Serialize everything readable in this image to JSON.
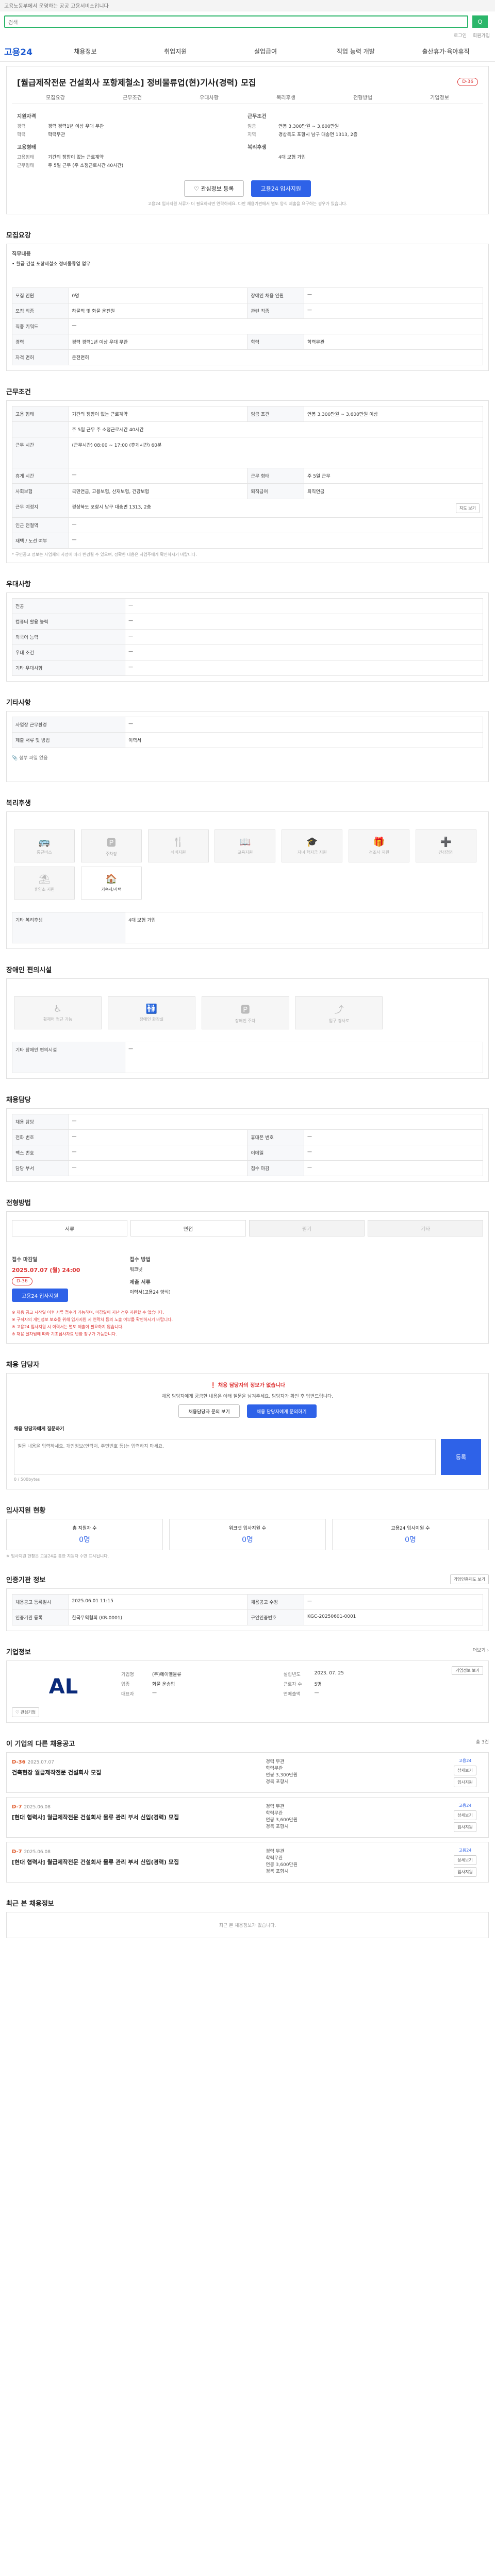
{
  "topbar": {
    "notice": "고용노동부에서 운영하는 공공 고용서비스입니다"
  },
  "search": {
    "placeholder": "검색",
    "button": "Q"
  },
  "util": {
    "login": "로그인",
    "join": "회원가입"
  },
  "nav": {
    "logo": "고용24",
    "items": [
      "채용정보",
      "취업지원",
      "실업급여",
      "직업 능력 개발",
      "출산휴가·육아휴직"
    ]
  },
  "header": {
    "tabs": [
      "모집요강",
      "근무조건",
      "우대사항",
      "복리후생",
      "전형방법",
      "기업정보"
    ],
    "title": "[월급제작전문 건설회사 포항제철소] 정비물류업(현)기사(경력) 모집",
    "dday": "D-36",
    "left_head": "지원자격",
    "right_head": "근무조건",
    "left_kv": [
      {
        "k": "경력",
        "v": "경력 경력1년 이상 우대 무관"
      },
      {
        "k": "학력",
        "v": "학력무관"
      }
    ],
    "right_kv": [
      {
        "k": "임금",
        "v": "연봉 3,300만원 ~ 3,600만원"
      },
      {
        "k": "지역",
        "v": "경상북도 포항시 남구 대송면 1313, 2층"
      }
    ],
    "left_head2": "고용형태",
    "right_head2": "복리후생",
    "left_kv2": [
      {
        "k": "고용형태",
        "v": "기간의 정함이 없는 근로계약"
      },
      {
        "k": "근무형태",
        "v": "주 5일 근무 (주 소정근로시간 40시간)"
      }
    ],
    "right_kv2": [
      {
        "k": "",
        "v": "4대 보험 가입"
      }
    ],
    "btn_save": "♡ 관심정보 등록",
    "btn_apply": "고용24 입사지원",
    "note": "고용24 입사지원 서류가 더 필요하시면 연락하세요. 다만 채용기관에서 별도 양식 제출을 요구하는 경우가 있습니다."
  },
  "recruit": {
    "heading": "모집요강",
    "duty_label": "직무내용",
    "duty": "• 월급 건설 포항제철소 정비물류업 업무",
    "rows": [
      {
        "k1": "모집 인원",
        "v1": "0명",
        "k2": "장애인 채용 인원",
        "v2": "—"
      },
      {
        "k1": "모집 직종",
        "v1": "하물적 및 화물 운전원",
        "k2": "관련 직종",
        "v2": "—"
      },
      {
        "k1": "직종 키워드",
        "v1": "—",
        "k2": "",
        "v2": ""
      },
      {
        "k1": "경력",
        "v1": "경력 경력1년 이상 우대 무관",
        "k2": "학력",
        "v2": "학력무관"
      },
      {
        "k1": "자격 면허",
        "v1": "운전면허"
      }
    ]
  },
  "conditions": {
    "heading": "근무조건",
    "rows": [
      {
        "k1": "고용 형태",
        "v1": "기간의 정함이 없는 근로계약",
        "k2": "임금 조건",
        "v2": "연봉 3,300만원 ~ 3,600만원 이상"
      },
      {
        "k1": "",
        "v1": "주 5일 근무 주 소정근로시간 40시간",
        "k2": "",
        "v2": ""
      },
      {
        "k1": "근무 시간",
        "v1": "(근무시간) 08:00 ~ 17:00 (휴게시간) 60분",
        "k2": "",
        "v2": ""
      },
      {
        "k1": "휴게 시간",
        "v1": "—",
        "k2": "근무 형태",
        "v2": "주 5일 근무"
      },
      {
        "k1": "사회보험",
        "v1": "국민연금, 고용보험, 산재보험, 건강보험",
        "k2": "퇴직급여",
        "v2": "퇴직연금"
      },
      {
        "k1": "근무 예정지",
        "v1": "경상북도 포항시 남구 대송면 1313, 2층",
        "k2": "",
        "v2": ""
      },
      {
        "k1": "인근 전철역",
        "v1": "—"
      },
      {
        "k1": "재택 / 노선 여부",
        "v1": "—"
      }
    ],
    "map_btn": "지도 보기",
    "note": "* 구인공고 정보는 사업체의 사정에 따라 변경될 수 있으며, 정확한 내용은 사업주에게 확인하시기 바랍니다."
  },
  "prefer": {
    "heading": "우대사항",
    "rows": [
      {
        "k": "전공",
        "v": "—"
      },
      {
        "k": "컴퓨터 활용 능력",
        "v": "—"
      },
      {
        "k": "외국어 능력",
        "v": "—"
      },
      {
        "k": "우대 조건",
        "v": "—"
      },
      {
        "k": "기타 우대사항",
        "v": "—"
      }
    ]
  },
  "etc": {
    "heading": "기타사항",
    "rows": [
      {
        "k": "사업장 근무환경",
        "v": "—"
      },
      {
        "k": "제출 서류 및 방법",
        "v": "이력서"
      }
    ],
    "attach": "첨부 파일 없음"
  },
  "welfare": {
    "heading": "복리후생",
    "items": [
      "통근버스",
      "주차장",
      "식비지원",
      "교육지원",
      "자녀 학자금 지원",
      "경조사 지원",
      "건강검진",
      "휴양소 지원",
      "기숙사/사택"
    ],
    "icons": [
      "🚌",
      "🅿",
      "🍴",
      "📖",
      "🎓",
      "🎁",
      "➕",
      "⛱",
      "🏠"
    ],
    "extra_label": "기타 복리후생",
    "extra": "4대 보험 가입"
  },
  "disabled": {
    "heading": "장애인 편의시설",
    "items": [
      "휠체어 접근 가능",
      "장애인 화장실",
      "장애인 주차",
      "입구 경사로"
    ],
    "icons": [
      "♿",
      "🚻",
      "🅿",
      "⤴"
    ],
    "extra_label": "기타 장애인 편의시설",
    "extra": "—"
  },
  "manager": {
    "heading": "채용담당",
    "rows": [
      {
        "k1": "채용 담당",
        "v1": "—",
        "k2": "",
        "v2": ""
      },
      {
        "k1": "전화 번호",
        "v1": "—",
        "k2": "휴대폰 번호",
        "v2": "—"
      },
      {
        "k1": "팩스 번호",
        "v1": "—",
        "k2": "이메일",
        "v2": "—"
      },
      {
        "k1": "담당 부서",
        "v1": "—",
        "k2": "접수 마감",
        "v2": "—"
      }
    ]
  },
  "method": {
    "heading": "전형방법",
    "items": [
      "서류",
      "면접",
      "필기",
      "기타"
    ],
    "period_label": "접수 마감일",
    "period": "2025.07.07 (월) 24:00",
    "period_dday": "D-36",
    "apply_method_label": "접수 방법",
    "apply_method": "워크넷",
    "docs_label": "제출 서류",
    "docs": "이력서(고용24 양식)",
    "apply_btn": "고용24 입사지원",
    "notes": [
      "※ 채용 공고 시작일 이후 서류 접수가 가능하며, 마감일이 지난 경우 지원할 수 없습니다.",
      "※ 구직자의 개인정보 보호를 위해 입사지원 시 연락처 등의 노출 여부를 확인하시기 바랍니다.",
      "※ 고용24 입사지원 시 이력서는 별도 제출이 필요하지 않습니다.",
      "※ 채용 절차법에 따라 기초심사자료 반환 청구가 가능합니다."
    ]
  },
  "contact": {
    "heading": "채용 담당자",
    "warn": "❗ 채용 담당자의 정보가 없습니다",
    "desc": "채용 담당자에게 궁금한 내용은 아래 질문을 남겨주세요. 담당자가 확인 후 답변드립니다.",
    "btn_view": "채용담당자 문의 보기",
    "btn_ask": "채용 담당자에게 문의하기",
    "qa_title": "채용 담당자에게 질문하기",
    "qa_placeholder": "질문 내용을 입력하세요. 개인정보(연락처, 주민번호 등)는 입력하지 마세요.",
    "qa_count": "0 / 500bytes",
    "qa_submit": "등록"
  },
  "stats": {
    "heading": "입사지원 현황",
    "items": [
      {
        "label": "총 지원자 수",
        "n": "0명"
      },
      {
        "label": "워크넷 입사지원 수",
        "n": "0명"
      },
      {
        "label": "고용24 입사지원 수",
        "n": "0명"
      }
    ],
    "note": "※ 입사지원 현황은 고용24를 통한 지원자 수만 표시됩니다."
  },
  "info": {
    "heading": "인증기관 정보",
    "btn": "기업인증제도 보기",
    "rows": [
      {
        "k1": "채용공고 등록일시",
        "v1": "2025.06.01 11:15",
        "k2": "채용공고 수정",
        "v2": "—"
      },
      {
        "k1": "인증기관 등록",
        "v1": "한국무역협회 (KR-0001)",
        "k2": "구인인증번호",
        "v2": "KGC-20250601-0001"
      }
    ]
  },
  "company": {
    "heading": "기업정보",
    "more": "더보기 ›",
    "logo": "AL",
    "btn_save": "♡ 관심기업",
    "btn_more": "기업정보 보기",
    "rows": [
      {
        "k": "기업명",
        "v": "(주)에이엘물류"
      },
      {
        "k": "업종",
        "v": "화물 운송업"
      },
      {
        "k": "대표자",
        "v": "—"
      },
      {
        "k": "설립년도",
        "v": "2023. 07. 25"
      },
      {
        "k": "근로자 수",
        "v": "5명"
      },
      {
        "k": "연매출액",
        "v": "—"
      }
    ]
  },
  "others": {
    "heading": "이 기업의 다른 채용공고",
    "sub": "총 3건",
    "jobs": [
      {
        "dday": "D-36",
        "date": "2025.07.07",
        "title": "건축현장 월급제작전문 건설회사 모집",
        "career": "경력 무관",
        "edu": "학력무관",
        "pay": "연봉 3,300만원",
        "loc": "경북 포항시",
        "tag": "고용24"
      },
      {
        "dday": "D-7",
        "date": "2025.06.08",
        "title": "[현대 협력사] 월급제작전문 건설회사 물류 관리 부서 신입(경력) 모집",
        "career": "경력 무관",
        "edu": "학력무관",
        "pay": "연봉 3,600만원",
        "loc": "경북 포항시",
        "tag": "고용24"
      },
      {
        "dday": "D-7",
        "date": "2025.06.08",
        "title": "[현대 협력사] 월급제작전문 건설회사 물류 관리 부서 신입(경력) 모집",
        "career": "경력 무관",
        "edu": "학력무관",
        "pay": "연봉 3,600만원",
        "loc": "경북 포항시",
        "tag": "고용24"
      }
    ],
    "btn_view": "상세보기",
    "btn_apply": "입사지원"
  },
  "recent": {
    "heading": "최근 본 채용정보",
    "empty": "최근 본 채용정보가 없습니다."
  }
}
